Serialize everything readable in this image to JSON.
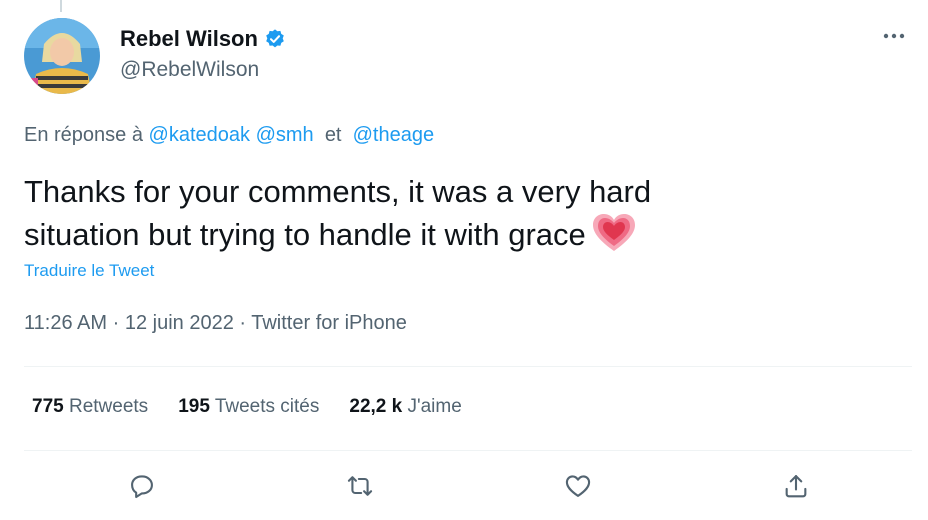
{
  "author": {
    "display_name": "Rebel Wilson",
    "handle": "@RebelWilson",
    "verified": true
  },
  "reply": {
    "prefix": "En réponse à",
    "mention1": "@katedoak",
    "mention2": "@smh",
    "conjunction": "et",
    "mention3": "@theage"
  },
  "tweet": {
    "line1": "Thanks for your comments, it was a very hard",
    "line2": "situation but trying to handle it with grace",
    "emoji": "growing-heart",
    "translate_label": "Traduire le Tweet"
  },
  "meta": {
    "time": "11:26 AM",
    "separator": "·",
    "date": "12 juin 2022",
    "source": "Twitter for iPhone"
  },
  "stats": {
    "retweets_count": "775",
    "retweets_label": "Retweets",
    "quotes_count": "195",
    "quotes_label": "Tweets cités",
    "likes_count": "22,2 k",
    "likes_label": "J'aime"
  },
  "actions": {
    "reply_icon": "reply-icon",
    "retweet_icon": "retweet-icon",
    "like_icon": "like-icon",
    "share_icon": "share-icon"
  },
  "colors": {
    "accent": "#1d9bf0",
    "text": "#0f1419",
    "secondary": "#536471",
    "divider": "#eff3f4"
  }
}
